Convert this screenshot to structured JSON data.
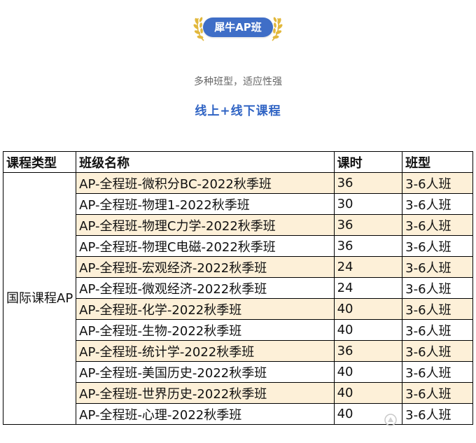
{
  "badge": {
    "label": "犀牛AP班"
  },
  "subtitle": "多种班型，适应性强",
  "headline": "线上+线下课程",
  "table": {
    "headers": [
      "课程类型",
      "班级名称",
      "课时",
      "班型"
    ],
    "course_type": "国际课程AP",
    "rows": [
      {
        "name": "AP-全程班-微积分BC-2022秋季班",
        "hours": "36",
        "class_type": "3-6人班"
      },
      {
        "name": "AP-全程班-物理1-2022秋季班",
        "hours": "30",
        "class_type": "3-6人班"
      },
      {
        "name": "AP-全程班-物理C力学-2022秋季班",
        "hours": "36",
        "class_type": "3-6人班"
      },
      {
        "name": "AP-全程班-物理C电磁-2022秋季班",
        "hours": "36",
        "class_type": "3-6人班"
      },
      {
        "name": "AP-全程班-宏观经济-2022秋季班",
        "hours": "24",
        "class_type": "3-6人班"
      },
      {
        "name": "AP-全程班-微观经济-2022秋季班",
        "hours": "24",
        "class_type": "3-6人班"
      },
      {
        "name": "AP-全程班-化学-2022秋季班",
        "hours": "40",
        "class_type": "3-6人班"
      },
      {
        "name": "AP-全程班-生物-2022秋季班",
        "hours": "40",
        "class_type": "3-6人班"
      },
      {
        "name": "AP-全程班-统计学-2022秋季班",
        "hours": "36",
        "class_type": "3-6人班"
      },
      {
        "name": "AP-全程班-美国历史-2022秋季班",
        "hours": "40",
        "class_type": "3-6人班"
      },
      {
        "name": "AP-全程班-世界历史-2022秋季班",
        "hours": "40",
        "class_type": "3-6人班"
      },
      {
        "name": "AP-全程班-心理-2022秋季班",
        "hours": "40",
        "class_type": "3-6人班"
      }
    ]
  },
  "colors": {
    "badge_bg": "#3f6ec7",
    "laurel": "#e2b83c",
    "headline": "#3064c4",
    "row_shade": "#fdf0d8"
  },
  "icons": {
    "badge_decoration": "laurel-wreath-icon",
    "watermark": "watermark-logo-icon"
  }
}
